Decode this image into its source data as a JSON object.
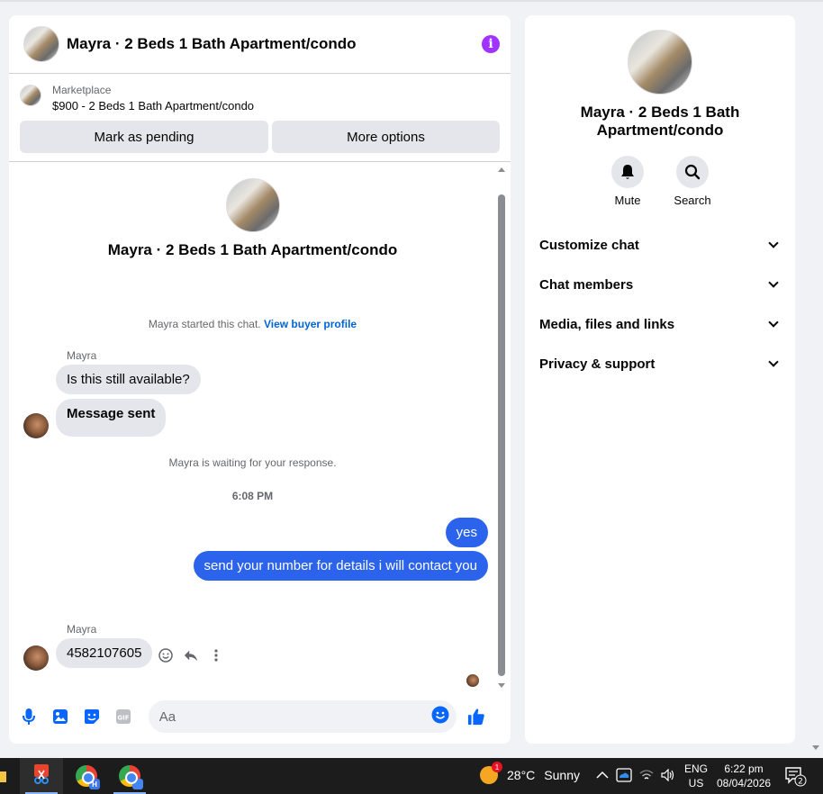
{
  "chat": {
    "title": "Mayra · 2 Beds 1 Bath Apartment/condo",
    "marketplace_label": "Marketplace",
    "marketplace_item": "$900 - 2 Beds 1 Bath Apartment/condo",
    "mark_pending_label": "Mark as pending",
    "more_options_label": "More options",
    "intro_title": "Mayra · 2 Beds 1 Bath Apartment/condo",
    "started_text": "Mayra started this chat.",
    "view_profile_link": "View buyer profile",
    "sender_name_1": "Mayra",
    "msg_in_1": "Is this still available?",
    "msg_in_2": "Message sent",
    "waiting_text": "Mayra is waiting for your response.",
    "timestamp": "6:08 PM",
    "msg_out_1": "yes",
    "msg_out_2": "send your number for details i will contact you",
    "sender_name_2": "Mayra",
    "msg_in_3": "4582107605",
    "input_placeholder": "Aa"
  },
  "side": {
    "title": "Mayra · 2 Beds 1 Bath Apartment/condo",
    "mute_label": "Mute",
    "search_label": "Search",
    "items": [
      "Customize chat",
      "Chat members",
      "Media, files and links",
      "Privacy & support"
    ]
  },
  "taskbar": {
    "weather_badge": "1",
    "temperature": "28°C",
    "weather": "Sunny",
    "lang_top": "ENG",
    "lang_bottom": "US",
    "time": "6:22 pm",
    "date": "08/04/2026",
    "notification_count": "2",
    "chrome_badge": "H"
  },
  "colors": {
    "accent_blue": "#2b63ec",
    "link_blue": "#0064d1",
    "info_purple": "#a033ff",
    "page_bg": "#f0f2f5",
    "taskbar": "#1c1c1c"
  }
}
